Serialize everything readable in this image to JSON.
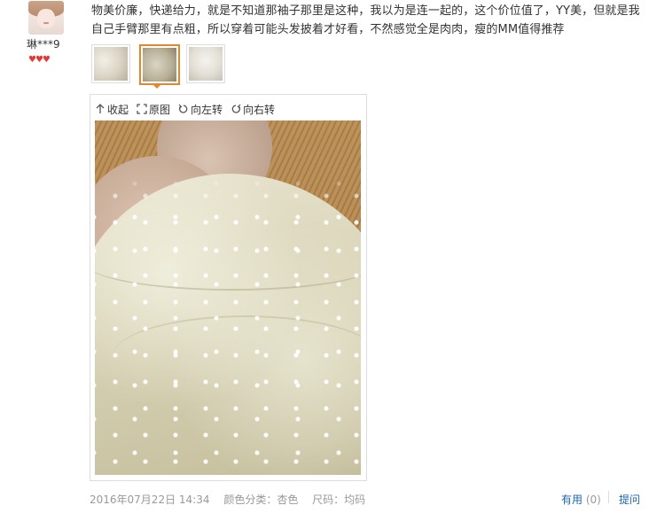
{
  "reviewer": {
    "username": "琳***9",
    "level_hearts": "♥♥♥"
  },
  "review": {
    "text": "物美价廉，快递给力，就是不知道那袖子那里是这种，我以为是连一起的，这个价位值了，YY美，但就是我自己手臂那里有点粗，所以穿着可能头发披着才好看，不然感觉全是肉肉，瘦的MM值得推荐"
  },
  "thumbnails": {
    "count": 3,
    "selected_index": 1
  },
  "viewer": {
    "collapse_label": "收起",
    "original_label": "原图",
    "rotate_left_label": "向左转",
    "rotate_right_label": "向右转"
  },
  "footer": {
    "date": "2016年07月22日 14:34",
    "color_spec": "颜色分类：杏色",
    "size_spec": "尺码：均码",
    "useful_label": "有用",
    "useful_count": "(0)",
    "ask_label": "提问"
  },
  "colors": {
    "link": "#1a66b3",
    "selected_border": "#e4862a",
    "meta_text": "#999999",
    "heart": "#e53935"
  }
}
